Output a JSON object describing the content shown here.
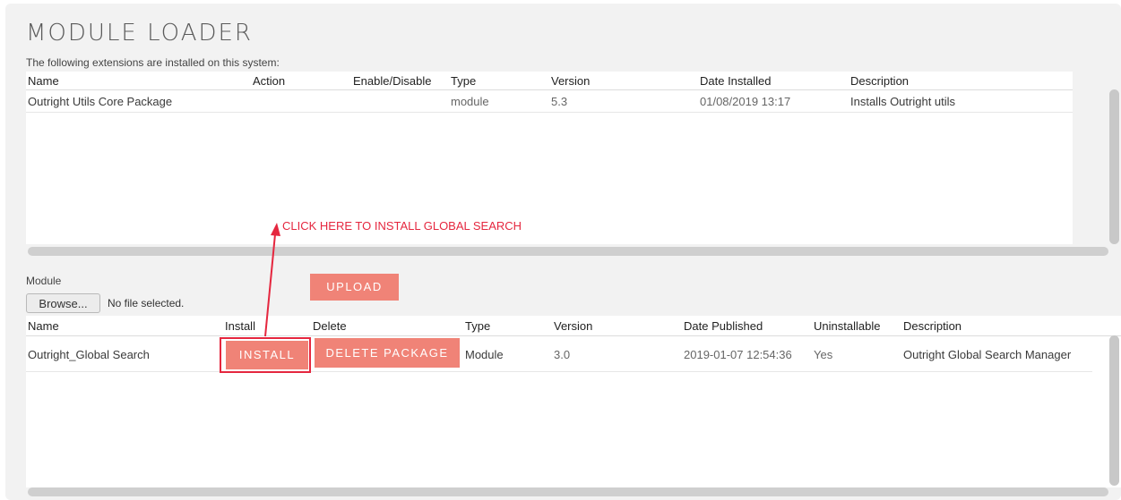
{
  "title": "MODULE LOADER",
  "subtitle": "The following extensions are installed on this system:",
  "installed": {
    "columns": [
      "Name",
      "Action",
      "Enable/Disable",
      "Type",
      "Version",
      "Date Installed",
      "Description"
    ],
    "rows": [
      {
        "name": "Outright Utils Core Package",
        "action": "",
        "enable": "",
        "type": "module",
        "version": "5.3",
        "date": "01/08/2019 13:17",
        "description": "Installs Outright utils"
      }
    ]
  },
  "upload": {
    "module_label": "Module",
    "browse_label": "Browse...",
    "file_status": "No file selected.",
    "upload_label": "UPLOAD"
  },
  "packages": {
    "columns": [
      "Name",
      "Install",
      "Delete",
      "Type",
      "Version",
      "Date Published",
      "Uninstallable",
      "Description"
    ],
    "rows": [
      {
        "name": "Outright_Global Search",
        "install_label": "INSTALL",
        "delete_label": "DELETE PACKAGE",
        "type": "Module",
        "version": "3.0",
        "date": "2019-01-07 12:54:36",
        "uninstallable": "Yes",
        "description": "Outright Global Search Manager"
      }
    ]
  },
  "annotation": {
    "text": "CLICK HERE TO INSTALL GLOBAL SEARCH",
    "color": "#e5273f"
  },
  "colors": {
    "button": "#f08377",
    "panel": "#f2f2f2"
  }
}
